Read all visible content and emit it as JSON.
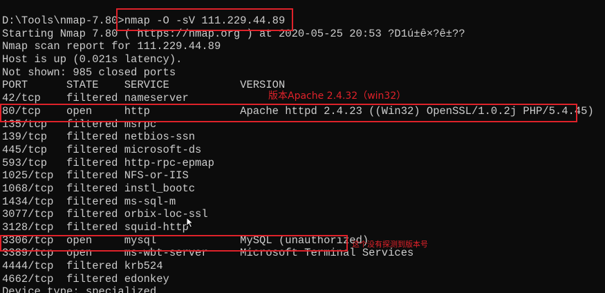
{
  "terminal": {
    "lines": [
      "D:\\Tools\\nmap-7.80>nmap -O -sV 111.229.44.89",
      "Starting Nmap 7.80 ( https://nmap.org ) at 2020-05-25 20:53 ?D1ú±ê×?ê±??",
      "Nmap scan report for 111.229.44.89",
      "Host is up (0.021s latency).",
      "Not shown: 985 closed ports",
      "PORT      STATE    SERVICE           VERSION",
      "42/tcp    filtered nameserver",
      "80/tcp    open     http              Apache httpd 2.4.23 ((Win32) OpenSSL/1.0.2j PHP/5.4.45)",
      "135/tcp   filtered msrpc",
      "139/tcp   filtered netbios-ssn",
      "445/tcp   filtered microsoft-ds",
      "593/tcp   filtered http-rpc-epmap",
      "1025/tcp  filtered NFS-or-IIS",
      "1068/tcp  filtered instl_bootc",
      "1434/tcp  filtered ms-sql-m",
      "3077/tcp  filtered orbix-loc-ssl",
      "3128/tcp  filtered squid-http",
      "3306/tcp  open     mysql             MySQL (unauthorized)",
      "3389/tcp  open     ms-wbt-server     Microsoft Terminal Services",
      "4444/tcp  filtered krb524",
      "4662/tcp  filtered edonkey",
      "Device type: specialized"
    ]
  },
  "annotations": {
    "apache_note": "版本Apache 2.4.32（win32）",
    "mysql_note": "这个没有探测到版本号",
    "highlight_color": "#e0222a"
  },
  "colors": {
    "background": "#0c0c0c",
    "text": "#cccccc"
  },
  "icons": {
    "cursor": "mouse-pointer-icon"
  }
}
